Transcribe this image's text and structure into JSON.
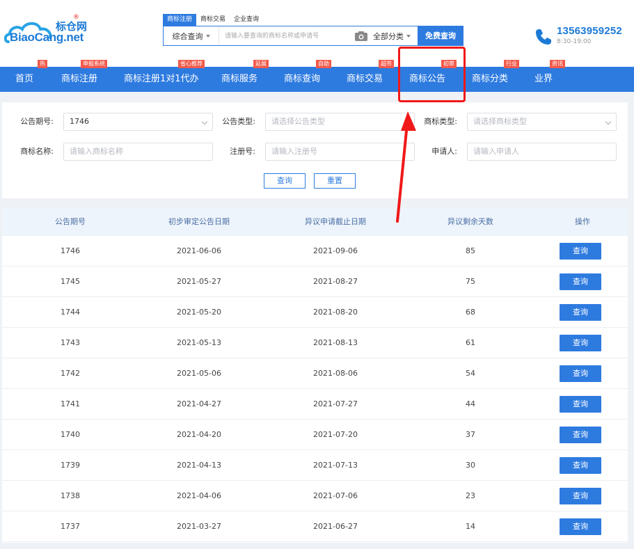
{
  "header": {
    "logo_en": "BiaoCang.net",
    "logo_cn": "标仓网",
    "logo_reg": "®",
    "search_tabs": [
      "商标注册",
      "商标交易",
      "企业查询"
    ],
    "search_select": "综合查询",
    "search_placeholder": "请输入要查询的商标名称或申请号",
    "category_select": "全部分类",
    "search_button": "免费查询",
    "phone": "13563959252",
    "hours": "8:30-19:00"
  },
  "nav": {
    "items": [
      {
        "label": "首页",
        "badge": "热"
      },
      {
        "label": "商标注册",
        "badge": "申报系统"
      },
      {
        "label": "商标注册1对1代办",
        "badge": "省心推荐"
      },
      {
        "label": "商标服务",
        "badge": "延展"
      },
      {
        "label": "商标查询",
        "badge": "自助"
      },
      {
        "label": "商标交易",
        "badge": "超市"
      },
      {
        "label": "商标公告",
        "badge": "初审"
      },
      {
        "label": "商标分类",
        "badge": "行业"
      },
      {
        "label": "业界",
        "badge": "资讯"
      }
    ]
  },
  "filters": {
    "issue_label": "公告期号:",
    "issue_value": "1746",
    "type_label": "公告类型:",
    "type_placeholder": "请选择公告类型",
    "tm_type_label": "商标类型:",
    "tm_type_placeholder": "请选择商标类型",
    "name_label": "商标名称:",
    "name_placeholder": "请输入商标名称",
    "reg_label": "注册号:",
    "reg_placeholder": "请输入注册号",
    "applicant_label": "申请人:",
    "applicant_placeholder": "请输入申请人",
    "query_button": "查询",
    "reset_button": "重置"
  },
  "table": {
    "headers": [
      "公告期号",
      "初步审定公告日期",
      "异议申请截止日期",
      "异议剩余天数",
      "操作"
    ],
    "action_label": "查询",
    "rows": [
      [
        "1746",
        "2021-06-06",
        "2021-09-06",
        "85"
      ],
      [
        "1745",
        "2021-05-27",
        "2021-08-27",
        "75"
      ],
      [
        "1744",
        "2021-05-20",
        "2021-08-20",
        "68"
      ],
      [
        "1743",
        "2021-05-13",
        "2021-08-13",
        "61"
      ],
      [
        "1742",
        "2021-05-06",
        "2021-08-06",
        "54"
      ],
      [
        "1741",
        "2021-04-27",
        "2021-07-27",
        "44"
      ],
      [
        "1740",
        "2021-04-20",
        "2021-07-20",
        "37"
      ],
      [
        "1739",
        "2021-04-13",
        "2021-07-13",
        "30"
      ],
      [
        "1738",
        "2021-04-06",
        "2021-07-06",
        "23"
      ],
      [
        "1737",
        "2021-03-27",
        "2021-06-27",
        "14"
      ]
    ]
  },
  "colors": {
    "brand_blue": "#2e7be0",
    "badge_red": "#f25a4b",
    "highlight_red": "#f01818"
  }
}
